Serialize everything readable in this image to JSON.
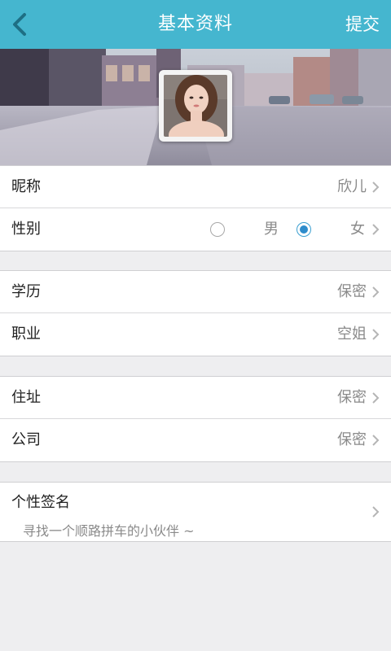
{
  "header": {
    "title": "基本资料",
    "submit_label": "提交"
  },
  "profile": {
    "nickname": {
      "label": "昵称",
      "value": "欣儿"
    },
    "gender": {
      "label": "性别",
      "options": [
        "男",
        "女"
      ],
      "selected": "女"
    }
  },
  "details": {
    "education": {
      "label": "学历",
      "value": "保密"
    },
    "occupation": {
      "label": "职业",
      "value": "空姐"
    }
  },
  "location": {
    "address": {
      "label": "住址",
      "value": "保密"
    },
    "company": {
      "label": "公司",
      "value": "保密"
    }
  },
  "signature": {
    "label": "个性签名",
    "value": "寻找一个顺路拼车的小伙伴 ~"
  },
  "colors": {
    "accent": "#45b6cf",
    "radio_selected": "#2e8ccb"
  }
}
